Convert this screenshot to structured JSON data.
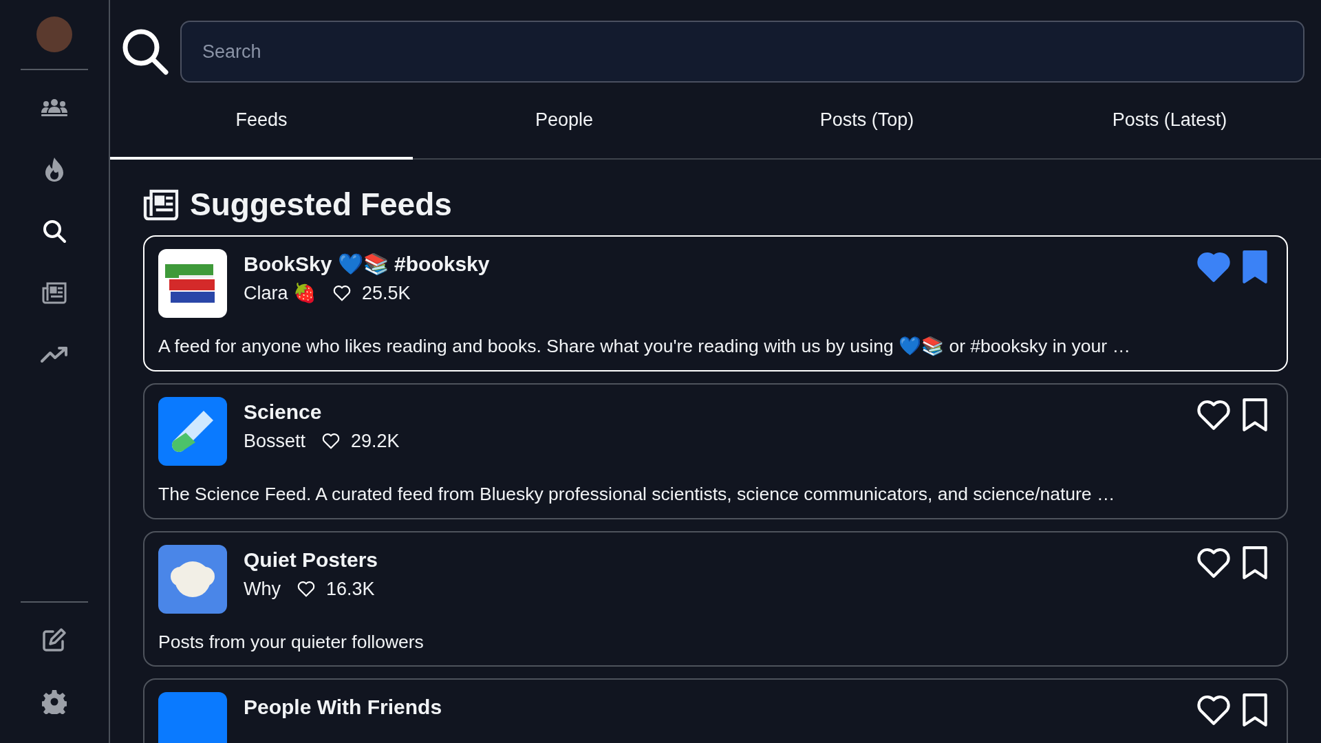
{
  "sidebar": {
    "items": [
      {
        "selected": false
      },
      {
        "selected": false
      },
      {
        "selected": true
      },
      {
        "selected": false
      },
      {
        "selected": false
      }
    ],
    "bottom_items": [
      {
        "selected": false
      },
      {
        "selected": false
      }
    ]
  },
  "search": {
    "placeholder": "Search"
  },
  "tabs": [
    {
      "label": "Feeds",
      "selected": true
    },
    {
      "label": "People",
      "selected": false
    },
    {
      "label": "Posts (Top)",
      "selected": false
    },
    {
      "label": "Posts (Latest)",
      "selected": false
    }
  ],
  "heading": "Suggested Feeds",
  "feeds": [
    {
      "title": "BookSky 💙📚 #booksky",
      "author": "Clara 🍓",
      "likes": "25.5K",
      "description": "A feed for anyone who likes reading and books. Share what you're reading with us by using 💙📚 or #booksky in your …",
      "liked": true,
      "saved": true,
      "selected": true,
      "color": "#ffffff"
    },
    {
      "title": "Science",
      "author": "Bossett",
      "likes": "29.2K",
      "description": "The Science Feed. A curated feed from Bluesky professional scientists,  science communicators, and science/nature …",
      "liked": false,
      "saved": false,
      "selected": false,
      "color": "#0a7aff"
    },
    {
      "title": "Quiet Posters",
      "author": "Why",
      "likes": "16.3K",
      "description": "Posts from your quieter followers",
      "liked": false,
      "saved": false,
      "selected": false,
      "color": "#4a86e8"
    },
    {
      "title": "People With Friends",
      "liked": false,
      "saved": false,
      "selected": false,
      "color": "#0a7aff"
    }
  ]
}
